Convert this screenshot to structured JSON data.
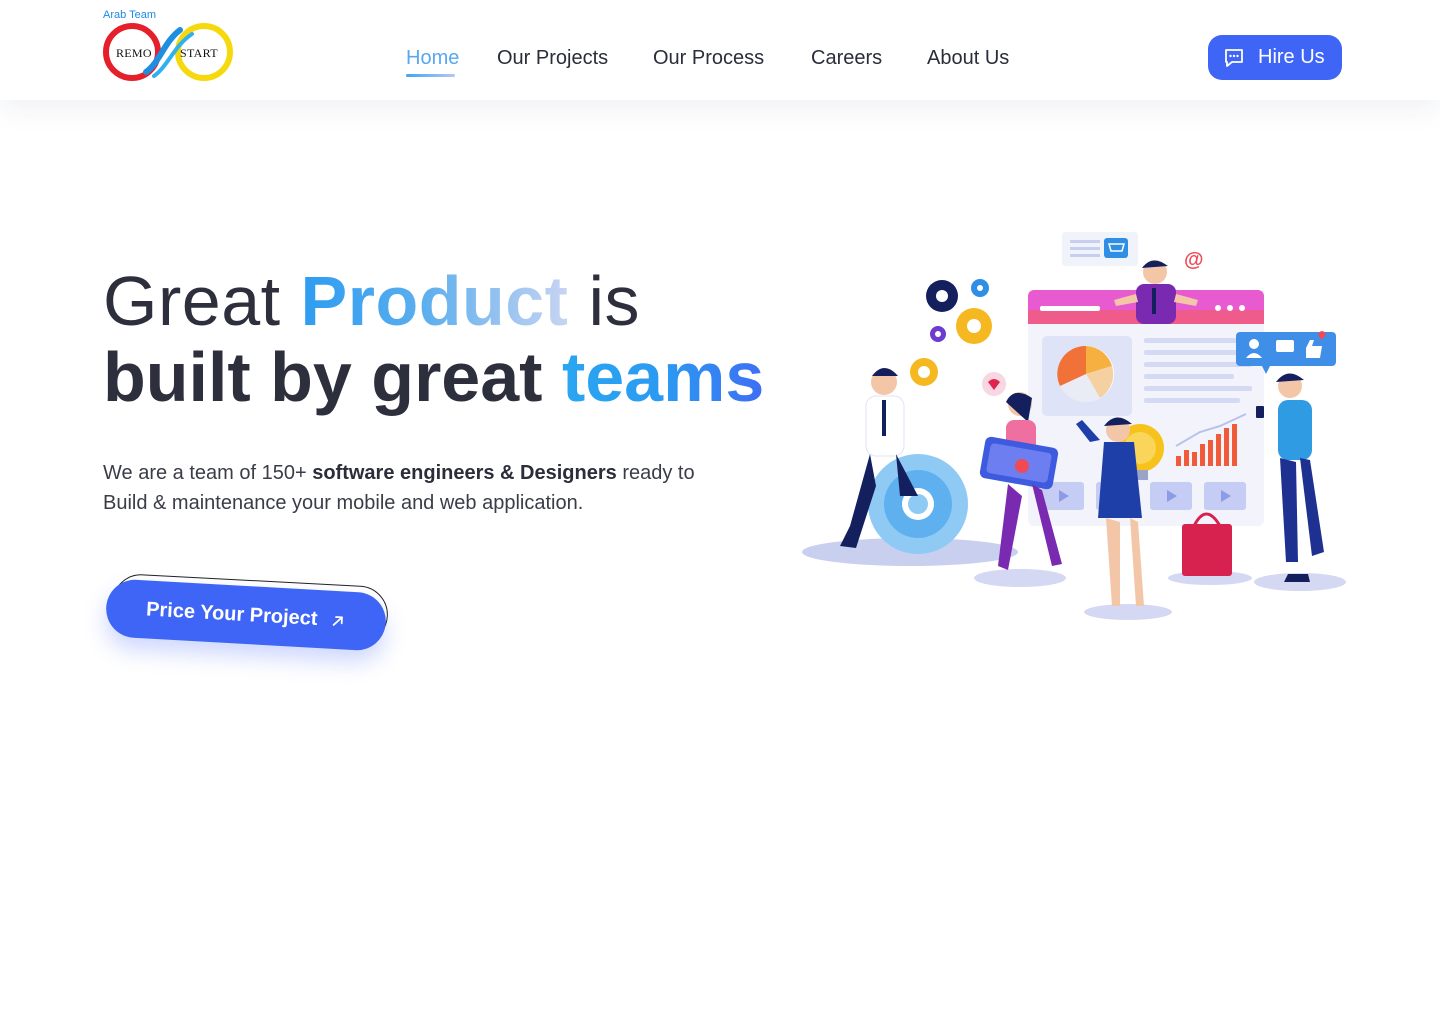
{
  "brand": {
    "tagline": "Arab Team",
    "logo_left_text": "REMO",
    "logo_right_text": "START"
  },
  "nav": {
    "items": [
      {
        "label": "Home",
        "active": true
      },
      {
        "label": "Our Projects",
        "active": false
      },
      {
        "label": "Our Process",
        "active": false
      },
      {
        "label": "Careers",
        "active": false
      },
      {
        "label": "About Us",
        "active": false
      }
    ]
  },
  "header": {
    "hire_label": "Hire Us",
    "hire_icon": "chat-icon"
  },
  "hero": {
    "title_part1": "Great",
    "title_highlight1": "Product",
    "title_part2": "is",
    "title_part3": "built by great",
    "title_highlight2": "teams",
    "subtitle_pre": "We are a team of 150+",
    "subtitle_bold": "software engineers & Designers",
    "subtitle_post": "ready to Build & maintenance your mobile and web application.",
    "cta_label": "Price Your Project",
    "cta_icon": "arrow-up-right-icon",
    "illustration": "team-collaboration-illustration",
    "illustration_at_symbol": "@"
  },
  "colors": {
    "accent": "#3e65f6",
    "highlight_blue": "#2b9af2",
    "nav_active": "#58a8ee",
    "text_dark": "#2e2f3d"
  }
}
